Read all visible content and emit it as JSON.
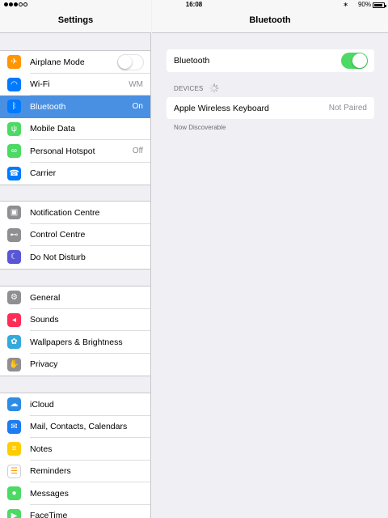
{
  "status_bar": {
    "time": "16:08",
    "battery_percent": "90%",
    "bluetooth_symbol": "∗",
    "signal_dots": 5,
    "signal_filled": 3
  },
  "left_panel": {
    "title": "Settings",
    "groups": [
      {
        "items": [
          {
            "label": "Airplane Mode",
            "icon": "airplane-icon",
            "icon_color": "#ff9500",
            "control": "toggle-off"
          },
          {
            "label": "Wi-Fi",
            "icon": "wifi-icon",
            "icon_color": "#007aff",
            "value": "WM"
          },
          {
            "label": "Bluetooth",
            "icon": "bluetooth-icon",
            "icon_color": "#007aff",
            "value": "On",
            "selected": true
          },
          {
            "label": "Mobile Data",
            "icon": "antenna-icon",
            "icon_color": "#4cd964"
          },
          {
            "label": "Personal Hotspot",
            "icon": "link-icon",
            "icon_color": "#4cd964",
            "value": "Off"
          },
          {
            "label": "Carrier",
            "icon": "phone-icon",
            "icon_color": "#007aff"
          }
        ]
      },
      {
        "items": [
          {
            "label": "Notification Centre",
            "icon": "notification-icon",
            "icon_color": "#8e8e93"
          },
          {
            "label": "Control Centre",
            "icon": "toggles-icon",
            "icon_color": "#8e8e93"
          },
          {
            "label": "Do Not Disturb",
            "icon": "moon-icon",
            "icon_color": "#5856d6"
          }
        ]
      },
      {
        "items": [
          {
            "label": "General",
            "icon": "gear-icon",
            "icon_color": "#8e8e93"
          },
          {
            "label": "Sounds",
            "icon": "speaker-icon",
            "icon_color": "#ff2d55"
          },
          {
            "label": "Wallpapers & Brightness",
            "icon": "flower-icon",
            "icon_color": "#34aadc"
          },
          {
            "label": "Privacy",
            "icon": "hand-icon",
            "icon_color": "#8e8e93"
          }
        ]
      },
      {
        "items": [
          {
            "label": "iCloud",
            "icon": "cloud-icon",
            "icon_color": "#2f8ce5"
          },
          {
            "label": "Mail, Contacts, Calendars",
            "icon": "mail-icon",
            "icon_color": "#1d7cf2"
          },
          {
            "label": "Notes",
            "icon": "notes-icon",
            "icon_color": "#ffcc00"
          },
          {
            "label": "Reminders",
            "icon": "list-icon",
            "icon_color": "#ffffff"
          },
          {
            "label": "Messages",
            "icon": "message-icon",
            "icon_color": "#4cd964"
          },
          {
            "label": "FaceTime",
            "icon": "video-icon",
            "icon_color": "#4cd964"
          }
        ]
      }
    ]
  },
  "right_panel": {
    "title": "Bluetooth",
    "bluetooth_label": "Bluetooth",
    "bluetooth_on": true,
    "devices_header": "DEVICES",
    "device": {
      "name": "Apple Wireless Keyboard",
      "status": "Not Paired"
    },
    "discoverable_text": "Now Discoverable"
  }
}
